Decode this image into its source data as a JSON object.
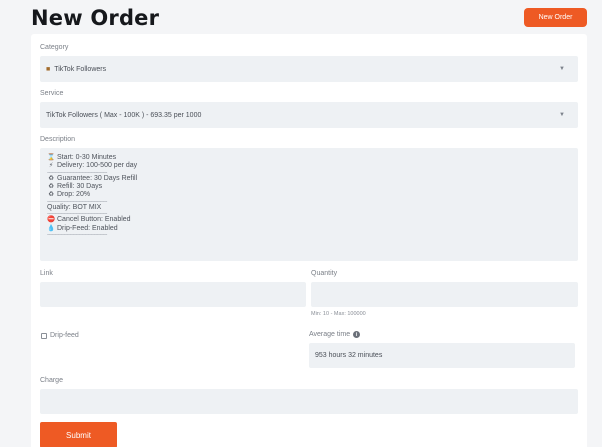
{
  "header": {
    "title": "New Order",
    "new_order_button": "New Order"
  },
  "form": {
    "category": {
      "label": "Category",
      "icon": "bear-icon",
      "value": "TikTok Followers"
    },
    "service": {
      "label": "Service",
      "value": "TikTok Followers ( Max - 100K ) - 693.35 per 1000"
    },
    "description": {
      "label": "Description",
      "lines": [
        {
          "icon": "⌛",
          "icon_name": "hourglass-icon",
          "text": "Start: 0-30 Minutes"
        },
        {
          "icon": "⚡",
          "icon_name": "lightning-icon",
          "text": "Delivery: 100-500 per day"
        },
        {
          "sep": true
        },
        {
          "icon": "♻",
          "icon_name": "recycle-icon",
          "text": "Guarantee: 30 Days Refill"
        },
        {
          "icon": "♻",
          "icon_name": "recycle-icon",
          "text": "Refill: 30 Days"
        },
        {
          "icon": "♻",
          "icon_name": "recycle-icon",
          "text": "Drop: 20%"
        },
        {
          "sep": true
        },
        {
          "icon": "",
          "icon_name": "",
          "text": "Quality: BOT MIX"
        },
        {
          "sep": true
        },
        {
          "icon": "⛔",
          "icon_name": "no-entry-icon",
          "text": "Cancel Button: Enabled"
        },
        {
          "icon": "💧",
          "icon_name": "droplet-icon",
          "text": "Drip-Feed: Enabled"
        },
        {
          "sep": true
        }
      ],
      "separator": "----------------------------------------"
    },
    "link": {
      "label": "Link",
      "value": ""
    },
    "quantity": {
      "label": "Quantity",
      "value": "",
      "hint": "Min: 10 - Max: 100000"
    },
    "drip_feed": {
      "label": "Drip-feed",
      "checked": false
    },
    "average_time": {
      "label": "Average time",
      "value": "953 hours 32 minutes"
    },
    "charge": {
      "label": "Charge",
      "value": ""
    },
    "submit_label": "Submit"
  },
  "colors": {
    "accent": "#ee5a24",
    "field_bg": "#eef1f4",
    "page_bg": "#f4f5f7"
  }
}
